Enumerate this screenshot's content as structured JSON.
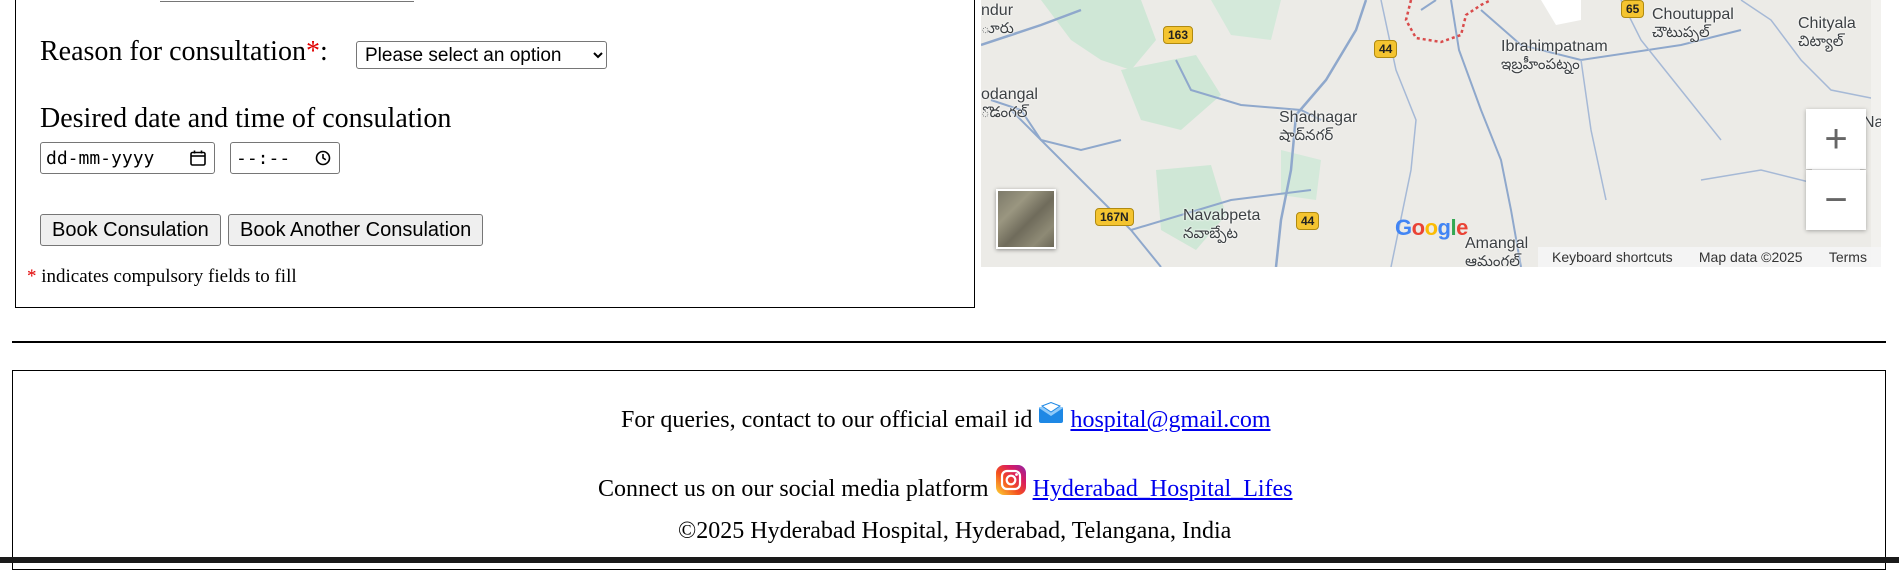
{
  "form": {
    "reason_label": "Reason for consultation",
    "required_marker": "*",
    "reason_colon": ":",
    "reason_select_value": "Please select an option",
    "reason_options": [
      "Please select an option"
    ],
    "datetime_label": "Desired date and time of consulation",
    "date_placeholder": "dd-mm-yyyy",
    "time_placeholder": "--:--",
    "book_button": "Book Consulation",
    "book_another_button": "Book Another Consulation",
    "note_marker": "*",
    "note_text": "indicates compulsory fields to fill"
  },
  "map": {
    "labels": {
      "ndur": "ndur",
      "ndur_te": "ూరు",
      "kodangal": "odangal",
      "kodangal_te": "ొడంగల్",
      "shadnagar": "Shadnagar",
      "shadnagar_te": "షాద్‌నగర్",
      "ibrahimpatnam": "Ibrahimpatnam",
      "ibrahimpatnam_te": "ఇబ్రహీంపట్నం",
      "choutuppal": "Choutuppal",
      "choutuppal_te": "చౌటుప్పల్",
      "chityala": "Chityala",
      "chityala_te": "చిట్యాల్",
      "navabpeta": "Navabpeta",
      "navabpeta_te": "నవాబ్పేట",
      "amangal": "Amangal",
      "amangal_te": "ఆమంగల్",
      "na": "Na"
    },
    "shields": {
      "h163": "163",
      "h44a": "44",
      "h44b": "44",
      "h167n": "167N",
      "h65": "65"
    },
    "google_logo": "Google",
    "zoom_in": "+",
    "zoom_out": "−",
    "footer": {
      "shortcuts": "Keyboard shortcuts",
      "map_data": "Map data ©2025",
      "terms": "Terms"
    }
  },
  "footer": {
    "email_prefix": "For queries, contact to our official email id",
    "email": "hospital@gmail.com",
    "social_prefix": "Connect us on our social media platform",
    "instagram": "Hyderabad_Hospital_Lifes",
    "copyright": "©2025 Hyderabad Hospital, Hyderabad, Telangana, India"
  },
  "colors": {
    "required": "#e00000",
    "link": "#0000ee",
    "map_land": "#ecebe7",
    "map_green": "#cfe7d6",
    "map_road": "#8fa8cc"
  },
  "icons": {
    "email": "envelope-icon",
    "instagram": "instagram-icon",
    "calendar": "calendar-icon",
    "clock": "clock-icon"
  }
}
